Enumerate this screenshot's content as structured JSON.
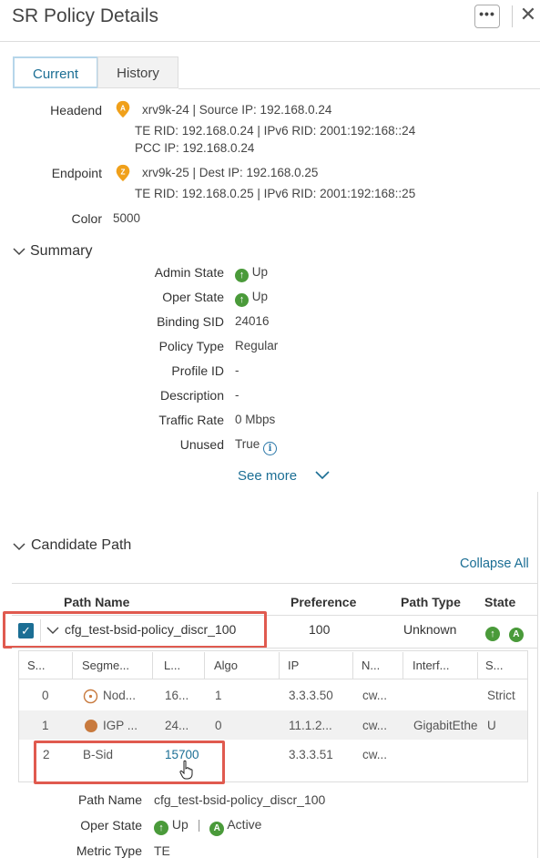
{
  "header": {
    "title": "SR Policy Details",
    "more_label": "•••",
    "close_label": "✕"
  },
  "tabs": [
    {
      "label": "Current"
    },
    {
      "label": "History"
    }
  ],
  "headend": {
    "label": "Headend",
    "pin_letter": "A",
    "line1": "xrv9k-24 | Source IP: 192.168.0.24",
    "line2": "TE RID: 192.168.0.24 | IPv6 RID: 2001:192:168::24",
    "line3": "PCC IP: 192.168.0.24"
  },
  "endpoint": {
    "label": "Endpoint",
    "pin_letter": "Z",
    "line1": "xrv9k-25 | Dest IP: 192.168.0.25",
    "line2": "TE RID: 192.168.0.25 | IPv6 RID: 2001:192:168::25"
  },
  "color": {
    "label": "Color",
    "value": "5000"
  },
  "summary": {
    "title": "Summary",
    "rows": [
      {
        "label": "Admin State",
        "value": "Up"
      },
      {
        "label": "Oper State",
        "value": "Up"
      },
      {
        "label": "Binding SID",
        "value": "24016"
      },
      {
        "label": "Policy Type",
        "value": "Regular"
      },
      {
        "label": "Profile ID",
        "value": "-"
      },
      {
        "label": "Description",
        "value": "-"
      },
      {
        "label": "Traffic Rate",
        "value": "0 Mbps"
      },
      {
        "label": "Unused",
        "value": "True"
      }
    ],
    "see_more": "See more"
  },
  "candidate": {
    "title": "Candidate Path",
    "collapse_all": "Collapse All",
    "headers": [
      "Path Name",
      "Preference",
      "Path Type",
      "State"
    ],
    "path": {
      "name": "cfg_test-bsid-policy_discr_100",
      "preference": "100",
      "type": "Unknown",
      "state_badge": "A"
    },
    "sub_headers": [
      "S...",
      "Segme...",
      "L...",
      "Algo",
      "IP",
      "N...",
      "Interf...",
      "S..."
    ],
    "sub_rows": [
      {
        "s": "0",
        "segment": "Nod...",
        "l": "16...",
        "algo": "1",
        "ip": "3.3.3.50",
        "n": "cw...",
        "interface": "",
        "s2": "Strict"
      },
      {
        "s": "1",
        "segment": "IGP ...",
        "l": "24...",
        "algo": "0",
        "ip": "11.1.2...",
        "n": "cw...",
        "interface": "GigabitEthe",
        "s2": "U"
      },
      {
        "s": "2",
        "segment": "B-Sid",
        "l": "15700",
        "algo": "",
        "ip": "3.3.3.51",
        "n": "cw...",
        "interface": "",
        "s2": ""
      }
    ],
    "details": [
      {
        "label": "Path Name",
        "value": "cfg_test-bsid-policy_discr_100"
      },
      {
        "label": "Oper State",
        "value": "Up",
        "value2": "Active",
        "badge": "A"
      },
      {
        "label": "Metric Type",
        "value": "TE"
      }
    ]
  },
  "icon_glyphs": {
    "up": "↑",
    "info": "i",
    "check": "✓",
    "chevron": "∨"
  },
  "colors": {
    "accent": "#1b6e94",
    "up_green": "#4a9a3a",
    "highlight_red": "#e05a4f",
    "pin_orange": "#f0a01a"
  }
}
